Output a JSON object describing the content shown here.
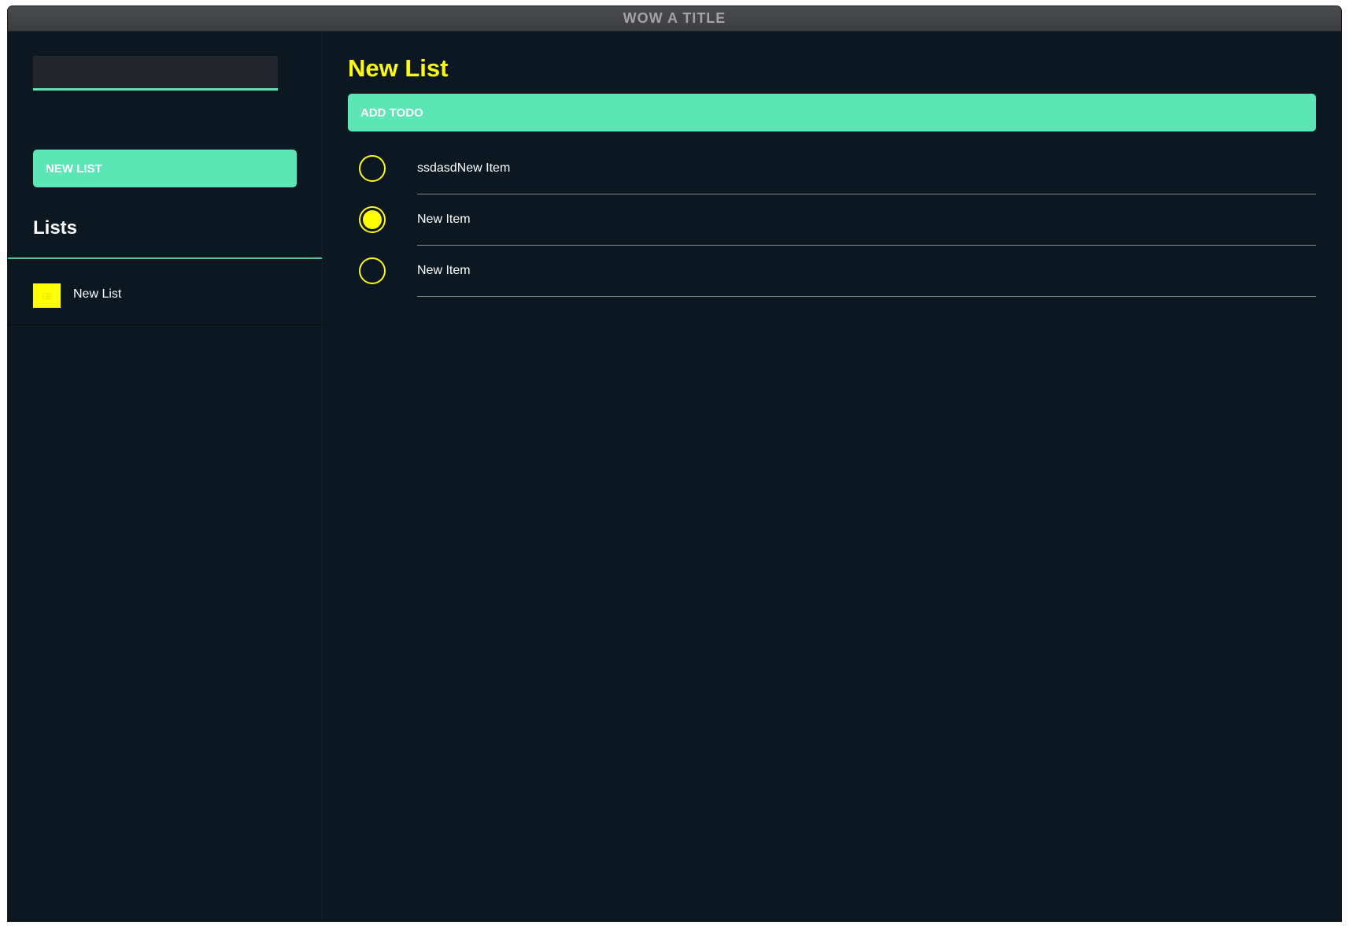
{
  "window": {
    "title": "WOW A TITLE"
  },
  "sidebar": {
    "search": {
      "value": "",
      "placeholder": ""
    },
    "new_list_label": "NEW LIST",
    "lists_heading": "Lists",
    "lists": [
      {
        "label": "New List",
        "icon": "list-icon"
      }
    ]
  },
  "main": {
    "title": "New List",
    "add_todo_label": "ADD TODO",
    "todos": [
      {
        "text": "ssdasdNew Item",
        "completed": false
      },
      {
        "text": "New Item",
        "completed": true
      },
      {
        "text": "New Item",
        "completed": false
      }
    ]
  },
  "colors": {
    "accent": "#5ce6b5",
    "highlight": "#ffff00",
    "background": "#0b1821",
    "titlebar": "#3f4145"
  }
}
